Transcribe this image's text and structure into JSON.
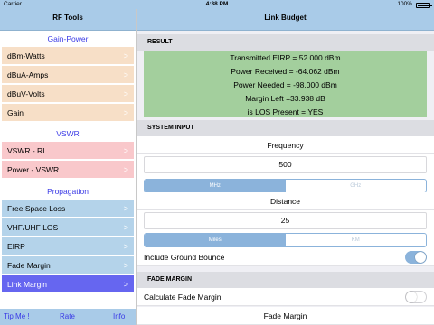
{
  "status": {
    "carrier": "Carrier",
    "time": "4:38 PM",
    "battery": "100%"
  },
  "sidebar": {
    "title": "RF Tools",
    "sections": {
      "gain_power": "Gain-Power",
      "vswr": "VSWR",
      "propagation": "Propagation"
    },
    "items": [
      {
        "label": "dBm-Watts",
        "chevron": ">"
      },
      {
        "label": "dBuA-Amps",
        "chevron": ">"
      },
      {
        "label": "dBuV-Volts",
        "chevron": ">"
      },
      {
        "label": "Gain",
        "chevron": ">"
      },
      {
        "label": "VSWR - RL",
        "chevron": ">"
      },
      {
        "label": "Power - VSWR",
        "chevron": ">"
      },
      {
        "label": "Free Space Loss",
        "chevron": ">"
      },
      {
        "label": "VHF/UHF LOS",
        "chevron": ">"
      },
      {
        "label": "EIRP",
        "chevron": ">"
      },
      {
        "label": "Fade Margin",
        "chevron": ">"
      },
      {
        "label": "Link Margin",
        "chevron": ">"
      }
    ],
    "footer": {
      "tip": "Tip Me !",
      "rate": "Rate",
      "info": "Info"
    }
  },
  "main": {
    "title": "Link Budget",
    "result": {
      "header": "RESULT",
      "lines": [
        "Transmitted EIRP = 52.000 dBm",
        "Power Received = -64.062 dBm",
        "Power Needed = -98.000 dBm",
        "Margin Left =33.938 dB",
        "is LOS Present = YES"
      ]
    },
    "system_input": {
      "header": "SYSTEM INPUT",
      "frequency_label": "Frequency",
      "frequency_value": "500",
      "freq_units": [
        "MHz",
        "GHz"
      ],
      "distance_label": "Distance",
      "distance_value": "25",
      "dist_units": [
        "Miles",
        "KM"
      ],
      "ground_bounce_label": "Include Ground Bounce",
      "ground_bounce_on": true
    },
    "fade_margin": {
      "header": "FADE MARGIN",
      "calc_label": "Calculate Fade Margin",
      "calc_on": false,
      "field_label": "Fade Margin"
    }
  },
  "colors": {
    "header_bar": "#a9cbe8",
    "section_title": "#3a3ae6",
    "item_peach": "#f7dfc7",
    "item_pink": "#f9c8cb",
    "item_blue": "#b4d3ea",
    "item_selected": "#6666f0",
    "result_green": "#a3cf9d",
    "segment_blue": "#8bb3db"
  }
}
